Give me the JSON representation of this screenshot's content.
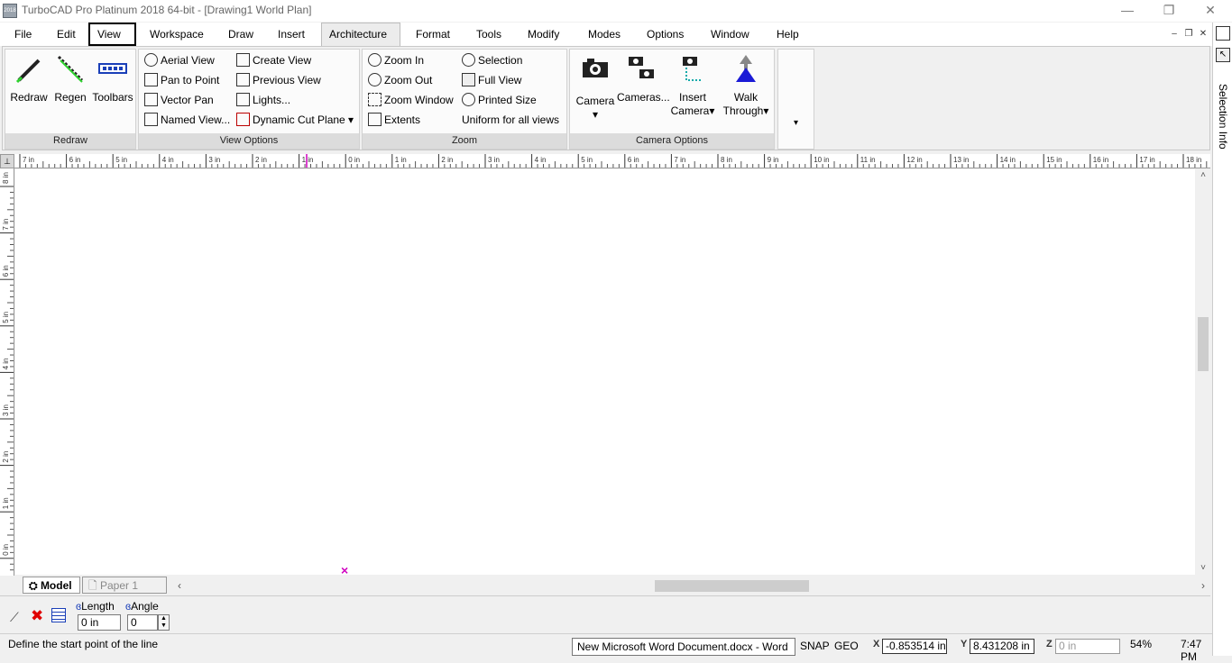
{
  "window": {
    "title": "TurboCAD Pro Platinum 2018 64-bit - [Drawing1 World Plan]",
    "controls": {
      "minimize": "—",
      "restore": "❐",
      "close": "✕"
    }
  },
  "menu": {
    "items": [
      "File",
      "Edit",
      "View",
      "Workspace",
      "Draw",
      "Insert",
      "Architecture",
      "Format",
      "Tools",
      "Modify",
      "Modes",
      "Options",
      "Window",
      "Help"
    ]
  },
  "ribbon": {
    "redraw": {
      "label": "Redraw",
      "buttons": [
        "Redraw",
        "Regen",
        "Toolbars"
      ]
    },
    "view_options": {
      "label": "View Options",
      "left": [
        "Aerial View",
        "Pan to Point",
        "Vector Pan",
        "Named View..."
      ],
      "right": [
        "Create View",
        "Previous View",
        "Lights...",
        "Dynamic Cut Plane"
      ]
    },
    "zoom": {
      "label": "Zoom",
      "left": [
        "Zoom In",
        "Zoom Out",
        "Zoom Window",
        "Extents"
      ],
      "right": [
        "Selection",
        "Full View",
        "Printed Size",
        "Uniform for all views"
      ]
    },
    "camera_options": {
      "label": "Camera Options",
      "camera": "Camera",
      "cameras": "Cameras...",
      "insert_camera_1": "Insert",
      "insert_camera_2": "Camera",
      "walk_through_1": "Walk",
      "walk_through_2": "Through"
    },
    "overflow_arrow": "▾"
  },
  "side_panel": {
    "tab": "Selection Info"
  },
  "rulers": {
    "horizontal": [
      "7 in",
      "6 in",
      "5 in",
      "4 in",
      "3 in",
      "2 in",
      "1 in",
      "0 in",
      "1 in",
      "2 in",
      "3 in",
      "4 in",
      "5 in",
      "6 in",
      "7 in",
      "8 in",
      "9 in",
      "10 in",
      "11 in",
      "12 in",
      "13 in",
      "14 in",
      "15 in",
      "16 in",
      "17 in",
      "18 in"
    ],
    "vertical": [
      "8 in",
      "7 in",
      "6 in",
      "5 in",
      "4 in",
      "3 in",
      "2 in",
      "1 in",
      "0 in"
    ]
  },
  "sheets": {
    "model": "Model",
    "paper": "Paper 1"
  },
  "inspector": {
    "length_label": "Length",
    "angle_label": "Angle",
    "length_value": "0 in",
    "angle_value": "0"
  },
  "status": {
    "message": "Define the start point of the line",
    "taskbar_tooltip": "New Microsoft Word Document.docx - Word",
    "snap": "SNAP",
    "geo": "GEO",
    "x_label": "X",
    "x": "-0.853514 in",
    "y_label": "Y",
    "y": "8.431208 in",
    "z_label": "Z",
    "z": "0 in",
    "zoom": "54%",
    "time": "7:47 PM"
  },
  "colors": {
    "cursor_marker": "#d000c0",
    "walk_through_icon": "#1b1bd6"
  }
}
